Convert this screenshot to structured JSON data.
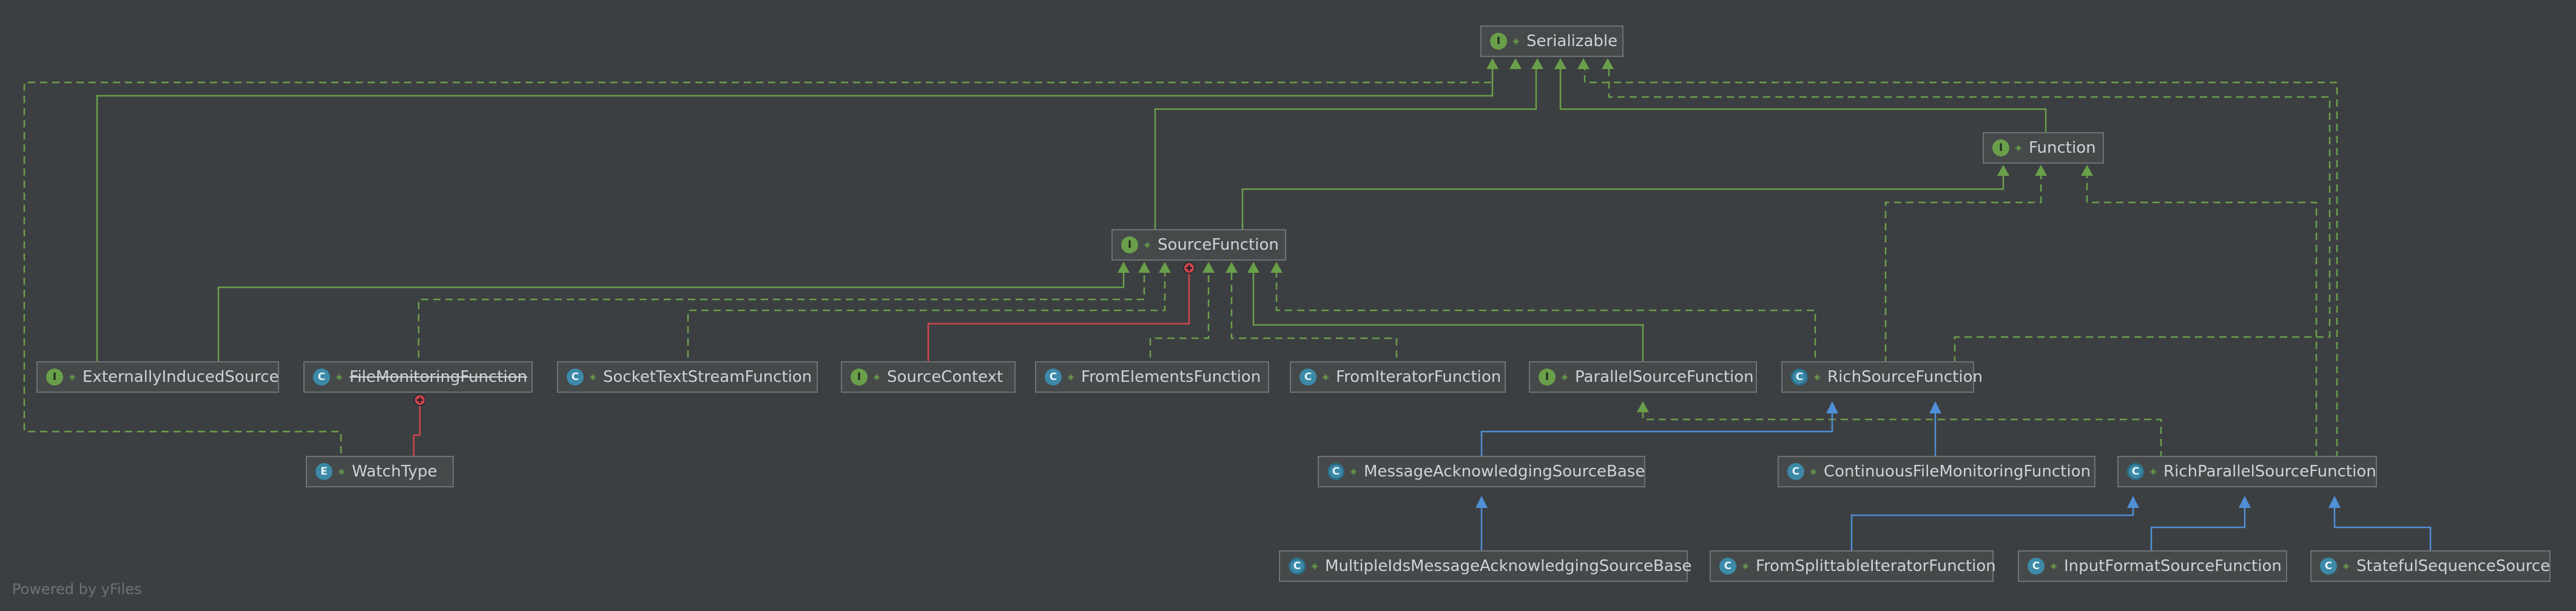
{
  "nodes": [
    {
      "id": "serializable",
      "label": "Serializable",
      "kind": "interface",
      "badge": "I"
    },
    {
      "id": "function",
      "label": "Function",
      "kind": "interface",
      "badge": "I"
    },
    {
      "id": "source-function",
      "label": "SourceFunction",
      "kind": "interface",
      "badge": "I"
    },
    {
      "id": "externally-induced-source",
      "label": "ExternallyInducedSource",
      "kind": "interface",
      "badge": "I"
    },
    {
      "id": "file-monitoring-function",
      "label": "FileMonitoringFunction",
      "kind": "class",
      "badge": "C",
      "deprecated": true
    },
    {
      "id": "socket-text-stream-function",
      "label": "SocketTextStreamFunction",
      "kind": "class",
      "badge": "C"
    },
    {
      "id": "source-context",
      "label": "SourceContext",
      "kind": "inner-interface",
      "badge": "I"
    },
    {
      "id": "from-elements-function",
      "label": "FromElementsFunction",
      "kind": "class",
      "badge": "C"
    },
    {
      "id": "from-iterator-function",
      "label": "FromIteratorFunction",
      "kind": "class",
      "badge": "C"
    },
    {
      "id": "parallel-source-function",
      "label": "ParallelSourceFunction",
      "kind": "interface",
      "badge": "I"
    },
    {
      "id": "rich-source-function",
      "label": "RichSourceFunction",
      "kind": "abstract-class",
      "badge": "C"
    },
    {
      "id": "watch-type",
      "label": "WatchType",
      "kind": "enum",
      "badge": "E"
    },
    {
      "id": "message-ack-source-base",
      "label": "MessageAcknowledgingSourceBase",
      "kind": "abstract-class",
      "badge": "C"
    },
    {
      "id": "continuous-file-monitoring-function",
      "label": "ContinuousFileMonitoringFunction",
      "kind": "class",
      "badge": "C"
    },
    {
      "id": "rich-parallel-source-function",
      "label": "RichParallelSourceFunction",
      "kind": "abstract-class",
      "badge": "C"
    },
    {
      "id": "multiple-ids-message-ack-source-base",
      "label": "MultipleIdsMessageAcknowledgingSourceBase",
      "kind": "abstract-class",
      "badge": "C"
    },
    {
      "id": "from-splittable-iterator-function",
      "label": "FromSplittableIteratorFunction",
      "kind": "class",
      "badge": "C"
    },
    {
      "id": "input-format-source-function",
      "label": "InputFormatSourceFunction",
      "kind": "class",
      "badge": "C"
    },
    {
      "id": "stateful-sequence-source",
      "label": "StatefulSequenceSource",
      "kind": "class",
      "badge": "C"
    }
  ],
  "edges": [
    {
      "from": "source-function",
      "to": "serializable",
      "type": "extends-interface"
    },
    {
      "from": "function",
      "to": "serializable",
      "type": "extends-interface"
    },
    {
      "from": "source-function",
      "to": "function",
      "type": "extends-interface"
    },
    {
      "from": "externally-induced-source",
      "to": "serializable",
      "type": "extends-interface"
    },
    {
      "from": "externally-induced-source",
      "to": "source-function",
      "type": "extends-interface"
    },
    {
      "from": "parallel-source-function",
      "to": "source-function",
      "type": "extends-interface"
    },
    {
      "from": "file-monitoring-function",
      "to": "source-function",
      "type": "implements"
    },
    {
      "from": "socket-text-stream-function",
      "to": "source-function",
      "type": "implements"
    },
    {
      "from": "from-elements-function",
      "to": "source-function",
      "type": "implements"
    },
    {
      "from": "from-iterator-function",
      "to": "source-function",
      "type": "implements"
    },
    {
      "from": "rich-source-function",
      "to": "source-function",
      "type": "implements"
    },
    {
      "from": "rich-source-function",
      "to": "function",
      "type": "implements"
    },
    {
      "from": "rich-source-function",
      "to": "serializable",
      "type": "implements"
    },
    {
      "from": "rich-parallel-source-function",
      "to": "parallel-source-function",
      "type": "implements"
    },
    {
      "from": "rich-parallel-source-function",
      "to": "function",
      "type": "implements"
    },
    {
      "from": "rich-parallel-source-function",
      "to": "serializable",
      "type": "implements"
    },
    {
      "from": "watch-type",
      "to": "serializable",
      "type": "implements"
    },
    {
      "from": "source-context",
      "to": "source-function",
      "type": "inner"
    },
    {
      "from": "watch-type",
      "to": "file-monitoring-function",
      "type": "inner"
    },
    {
      "from": "message-ack-source-base",
      "to": "rich-source-function",
      "type": "extends-class"
    },
    {
      "from": "continuous-file-monitoring-function",
      "to": "rich-source-function",
      "type": "extends-class"
    },
    {
      "from": "multiple-ids-message-ack-source-base",
      "to": "message-ack-source-base",
      "type": "extends-class"
    },
    {
      "from": "from-splittable-iterator-function",
      "to": "rich-parallel-source-function",
      "type": "extends-class"
    },
    {
      "from": "input-format-source-function",
      "to": "rich-parallel-source-function",
      "type": "extends-class"
    },
    {
      "from": "stateful-sequence-source",
      "to": "rich-parallel-source-function",
      "type": "extends-class"
    }
  ],
  "colors": {
    "background": "#3c3f41",
    "node_fill": "#45494a",
    "node_border": "#6f7274",
    "text": "#cfd3d6",
    "interface_edge": "#6a9f4a",
    "class_edge": "#4f8fd6",
    "inner_edge": "#d0454f",
    "interface_badge": "#6a9f4a",
    "class_badge": "#3c89a8"
  },
  "footer": "Powered by yFiles"
}
